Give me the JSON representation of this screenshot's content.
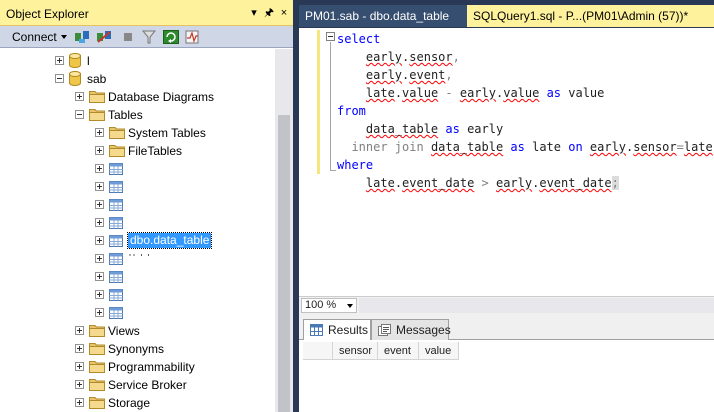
{
  "object_explorer": {
    "title": "Object Explorer",
    "pin": "↓",
    "autohide": "╀",
    "close": "×",
    "toolbar": {
      "connect_label": "Connect"
    },
    "tree": [
      {
        "name": "db-node-l",
        "label": "l",
        "type": "database",
        "expander": "plus"
      },
      {
        "name": "db-node-sab",
        "label": "sab",
        "type": "database",
        "expander": "minus"
      },
      {
        "name": "folder-database-diagrams",
        "label": "Database Diagrams",
        "type": "folder",
        "expander": "plus"
      },
      {
        "name": "folder-tables",
        "label": "Tables",
        "type": "folder",
        "expander": "minus"
      },
      {
        "name": "folder-system-tables",
        "label": "System Tables",
        "type": "folder",
        "expander": "plus"
      },
      {
        "name": "folder-filetables",
        "label": "FileTables",
        "type": "folder",
        "expander": "plus"
      },
      {
        "name": "table-node-1",
        "label": "",
        "type": "table",
        "expander": "plus"
      },
      {
        "name": "table-node-2",
        "label": "",
        "type": "table",
        "expander": "plus"
      },
      {
        "name": "table-node-3",
        "label": "",
        "type": "table",
        "expander": "plus"
      },
      {
        "name": "table-node-4",
        "label": "",
        "type": "table",
        "expander": "plus"
      },
      {
        "name": "table-node-data-table",
        "label": "dbo.data_table",
        "type": "table",
        "expander": "plus",
        "selected": true
      },
      {
        "name": "table-node-6",
        "label": "ˈˈ ˈ ˈ",
        "type": "table",
        "expander": "plus"
      },
      {
        "name": "table-node-7",
        "label": "",
        "type": "table",
        "expander": "plus"
      },
      {
        "name": "table-node-8",
        "label": "",
        "type": "table",
        "expander": "plus"
      },
      {
        "name": "table-node-9",
        "label": "",
        "type": "table",
        "expander": "plus"
      },
      {
        "name": "folder-views",
        "label": "Views",
        "type": "folder",
        "expander": "plus"
      },
      {
        "name": "folder-synonyms",
        "label": "Synonyms",
        "type": "folder",
        "expander": "plus"
      },
      {
        "name": "folder-programmability",
        "label": "Programmability",
        "type": "folder",
        "expander": "plus"
      },
      {
        "name": "folder-service-broker",
        "label": "Service Broker",
        "type": "folder",
        "expander": "plus"
      },
      {
        "name": "folder-storage",
        "label": "Storage",
        "type": "folder",
        "expander": "plus"
      }
    ]
  },
  "tabs": [
    {
      "label": "PM01.sab - dbo.data_table",
      "active": false
    },
    {
      "label": "SQLQuery1.sql - P...(PM01\\Admin (57))*",
      "active": true
    }
  ],
  "editor": {
    "lines": [
      [
        {
          "t": "select",
          "c": "kw"
        }
      ],
      [
        {
          "t": "    "
        },
        {
          "t": "early",
          "c": "sq"
        },
        {
          "t": "."
        },
        {
          "t": "sensor",
          "c": "sq"
        },
        {
          "t": ",",
          "c": "op"
        }
      ],
      [
        {
          "t": "    "
        },
        {
          "t": "early",
          "c": "sq"
        },
        {
          "t": "."
        },
        {
          "t": "event",
          "c": "sq"
        },
        {
          "t": ",",
          "c": "op"
        }
      ],
      [
        {
          "t": "    "
        },
        {
          "t": "late",
          "c": "sq"
        },
        {
          "t": "."
        },
        {
          "t": "value",
          "c": "sq"
        },
        {
          "t": " - ",
          "c": "op"
        },
        {
          "t": "early",
          "c": "sq"
        },
        {
          "t": "."
        },
        {
          "t": "value",
          "c": "sq"
        },
        {
          "t": " as ",
          "c": "kw"
        },
        {
          "t": "value"
        }
      ],
      [
        {
          "t": "from",
          "c": "kw"
        }
      ],
      [
        {
          "t": "    "
        },
        {
          "t": "data_table",
          "c": "sq"
        },
        {
          "t": " as ",
          "c": "kw"
        },
        {
          "t": "early"
        }
      ],
      [
        {
          "t": "  "
        },
        {
          "t": "inner join",
          "c": "op"
        },
        {
          "t": " "
        },
        {
          "t": "data_table",
          "c": "sq"
        },
        {
          "t": " as ",
          "c": "kw"
        },
        {
          "t": "late"
        },
        {
          "t": " on ",
          "c": "kw"
        },
        {
          "t": "early",
          "c": "sq"
        },
        {
          "t": "."
        },
        {
          "t": "sensor",
          "c": "sq"
        },
        {
          "t": "=",
          "c": "op"
        },
        {
          "t": "late",
          "c": "sq"
        },
        {
          "t": "."
        },
        {
          "t": "s",
          "c": "sq"
        }
      ],
      [
        {
          "t": "where",
          "c": "kw"
        }
      ],
      [
        {
          "t": "    "
        },
        {
          "t": "late",
          "c": "sq"
        },
        {
          "t": "."
        },
        {
          "t": "event_date",
          "c": "sq"
        },
        {
          "t": " > ",
          "c": "op"
        },
        {
          "t": "early",
          "c": "sq"
        },
        {
          "t": "."
        },
        {
          "t": "event_date",
          "c": "sq"
        },
        {
          "t": ";",
          "c": "op hl"
        }
      ]
    ]
  },
  "zoom": {
    "value": "100 %"
  },
  "results": {
    "tabs": [
      {
        "label": "Results"
      },
      {
        "label": "Messages"
      }
    ],
    "columns": [
      "sensor",
      "event",
      "value"
    ]
  }
}
